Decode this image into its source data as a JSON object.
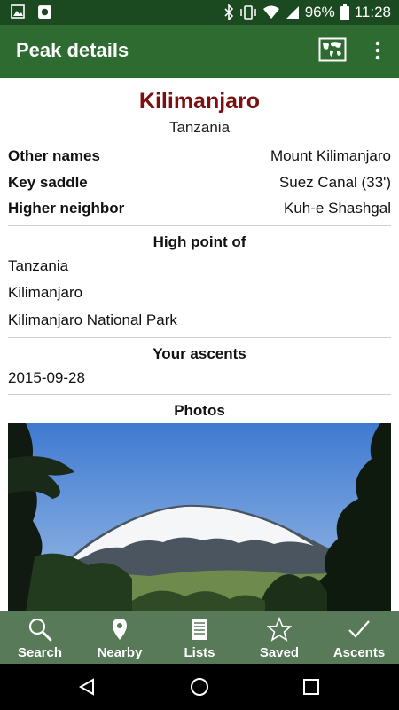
{
  "status_bar": {
    "battery": "96%",
    "time": "11:28"
  },
  "app_bar": {
    "title": "Peak details",
    "map_icon": "map-icon",
    "menu_icon": "overflow-menu-icon"
  },
  "peak": {
    "name": "Kilimanjaro",
    "country": "Tanzania"
  },
  "details": [
    {
      "label": "Other names",
      "value": "Mount Kilimanjaro"
    },
    {
      "label": "Key saddle",
      "value": "Suez Canal (33')"
    },
    {
      "label": "Higher neighbor",
      "value": "Kuh-e Shashgal"
    }
  ],
  "high_point_of": {
    "heading": "High point of",
    "items": [
      "Tanzania",
      "Kilimanjaro",
      "Kilimanjaro National Park"
    ]
  },
  "ascents": {
    "heading": "Your ascents",
    "items": [
      "2015-09-28"
    ]
  },
  "photos": {
    "heading": "Photos"
  },
  "bottom_nav": [
    {
      "label": "Search",
      "icon": "search-icon"
    },
    {
      "label": "Nearby",
      "icon": "location-pin-icon"
    },
    {
      "label": "Lists",
      "icon": "list-icon"
    },
    {
      "label": "Saved",
      "icon": "star-icon"
    },
    {
      "label": "Ascents",
      "icon": "checkmark-icon"
    }
  ],
  "colors": {
    "status_bar": "#1b4a20",
    "app_bar": "#2e6b30",
    "peak_name": "#7a1010",
    "bottom_nav": "#587a58"
  }
}
